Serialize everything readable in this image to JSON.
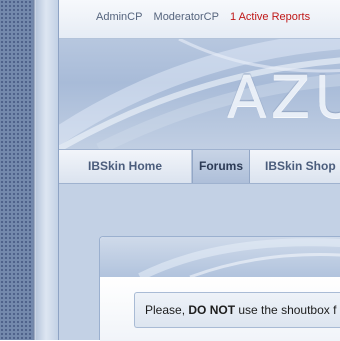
{
  "admin_bar": {
    "links": [
      "AdminCP",
      "ModeratorCP"
    ],
    "reports": "1 Active Reports"
  },
  "banner": {
    "logo_text": "AZU"
  },
  "nav": {
    "tabs": [
      "IBSkin Home",
      "Forums",
      "IBSkin Shop"
    ],
    "active": "Forums"
  },
  "notice": {
    "prefix": "Please, ",
    "emphasis": "DO NOT",
    "suffix": " use the shoutbox f"
  },
  "colors": {
    "report_red": "#c01818",
    "nav_text": "#4b5d7c",
    "rail": "#7489ad"
  }
}
